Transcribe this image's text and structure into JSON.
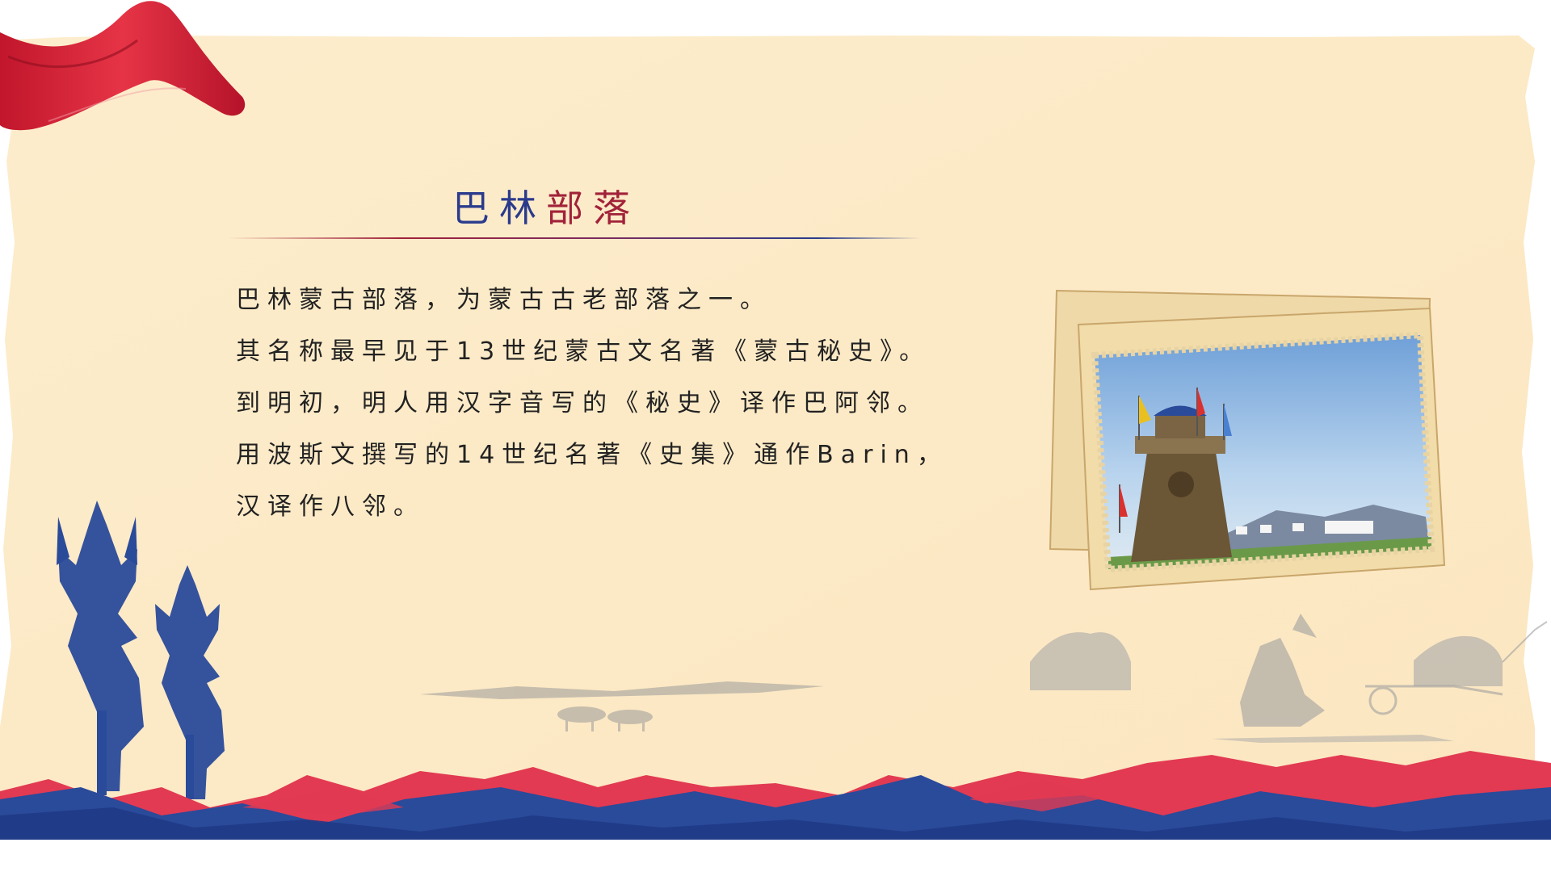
{
  "slide": {
    "title": {
      "part1": "巴林",
      "part2": "部落"
    },
    "paragraphs": [
      "巴林蒙古部落，为蒙古古老部落之一。",
      "其名称最早见于13世纪蒙古文名著《蒙古秘史》。",
      "到明初，明人用汉字音写的《秘史》译作巴阿邻。",
      "用波斯文撰写的14世纪名著《史集》通作Barin，",
      "汉译作八邻。"
    ]
  },
  "colors": {
    "paper": "#fcebc9",
    "accent_red": "#d9304a",
    "accent_blue": "#2a4a9a",
    "title_blue": "#2a3b8c",
    "title_red": "#a1223a"
  },
  "icons": [
    "red-ribbon-icon",
    "trident-sulde-icon",
    "yurt-icon",
    "horse-icon",
    "cart-icon"
  ]
}
